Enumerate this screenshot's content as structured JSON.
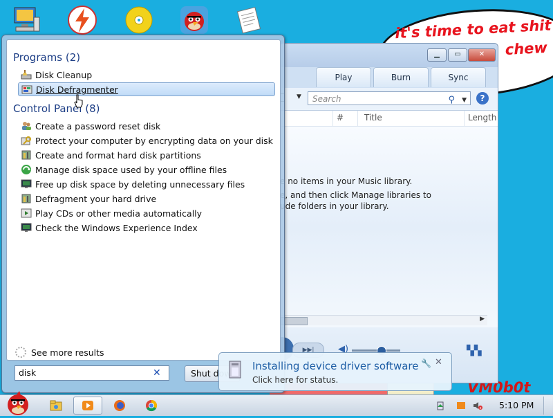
{
  "desktop": {
    "icons": [
      "computer-icon",
      "flash-app-icon",
      "disc-icon",
      "angry-bird-icon",
      "document-icon"
    ]
  },
  "bubble": {
    "line1": "it's time to eat shit",
    "line2": "chew"
  },
  "wmp": {
    "tabs": [
      "Play",
      "Burn",
      "Sync"
    ],
    "search_placeholder": "Search",
    "columns": [
      "#",
      "Title",
      "Length"
    ],
    "messages": [
      "e no items in your Music library.",
      "e, and then click Manage libraries to",
      "ude folders in your library."
    ]
  },
  "start_menu": {
    "programs_header": "Programs (2)",
    "programs": [
      {
        "label": "Disk Cleanup",
        "icon": "disk-cleanup-icon"
      },
      {
        "label": "Disk Defragmenter",
        "icon": "defragmenter-icon",
        "selected": true
      }
    ],
    "control_panel_header": "Control Panel (8)",
    "control_panel": [
      {
        "label": "Create a password reset disk",
        "icon": "users-icon"
      },
      {
        "label": "Protect your computer by encrypting data on your disk",
        "icon": "key-icon"
      },
      {
        "label": "Create and format hard disk partitions",
        "icon": "admin-tools-icon"
      },
      {
        "label": "Manage disk space used by your offline files",
        "icon": "sync-center-icon"
      },
      {
        "label": "Free up disk space by deleting unnecessary files",
        "icon": "monitor-icon"
      },
      {
        "label": "Defragment your hard drive",
        "icon": "admin-tools-icon"
      },
      {
        "label": "Play CDs or other media automatically",
        "icon": "autoplay-icon"
      },
      {
        "label": "Check the Windows Experience Index",
        "icon": "monitor-icon"
      }
    ],
    "see_more": "See more results",
    "search_value": "disk",
    "shutdown_label": "Shut down"
  },
  "balloon": {
    "title": "Installing device driver software",
    "subtitle": "Click here for status."
  },
  "watermark": "VM0b0t",
  "taskbar": {
    "clock": "5:10 PM"
  },
  "colors": {
    "desktop": "#1aaee0",
    "bubble_text": "#e8141e",
    "group_header": "#1e3f86",
    "balloon_title": "#1f5fa6"
  }
}
